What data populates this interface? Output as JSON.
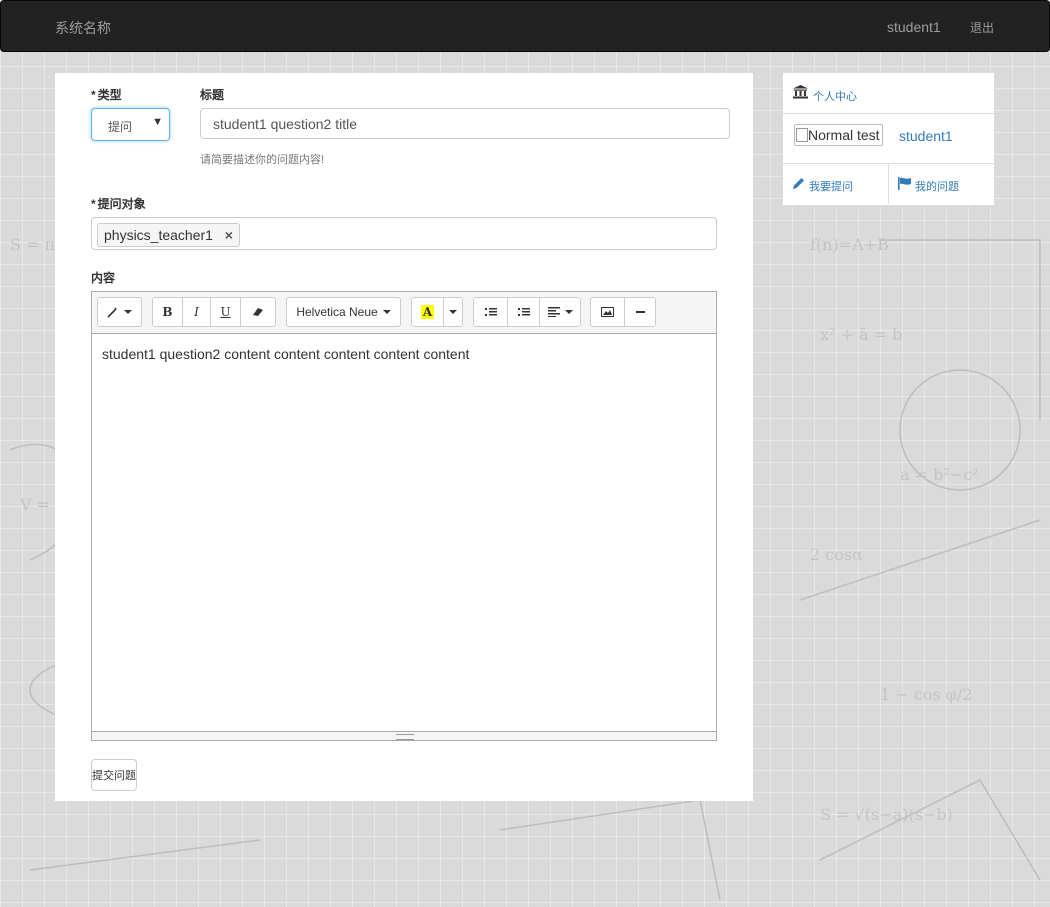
{
  "navbar": {
    "brand": "系统名称",
    "user": "student1",
    "logout": "退出"
  },
  "form": {
    "type": {
      "label": "类型",
      "selected": "提问"
    },
    "title": {
      "label": "标题",
      "value": "student1 question2 title",
      "help": "请简要描述你的问题内容!"
    },
    "teacher": {
      "label": "提问对象",
      "tags": [
        "physics_teacher1"
      ]
    },
    "content": {
      "label": "内容",
      "body": "student1 question2 content content content content content",
      "font_name": "Helvetica Neue"
    },
    "submit_label": "提交问题"
  },
  "sidebar": {
    "title": "个人中心",
    "avatar_alt": "Normal test",
    "username": "student1",
    "link_ask": "我要提问",
    "link_questions": "我的问题"
  },
  "colors": {
    "navbar": "#222222",
    "link": "#337ab7",
    "focus": "#66afe9"
  }
}
